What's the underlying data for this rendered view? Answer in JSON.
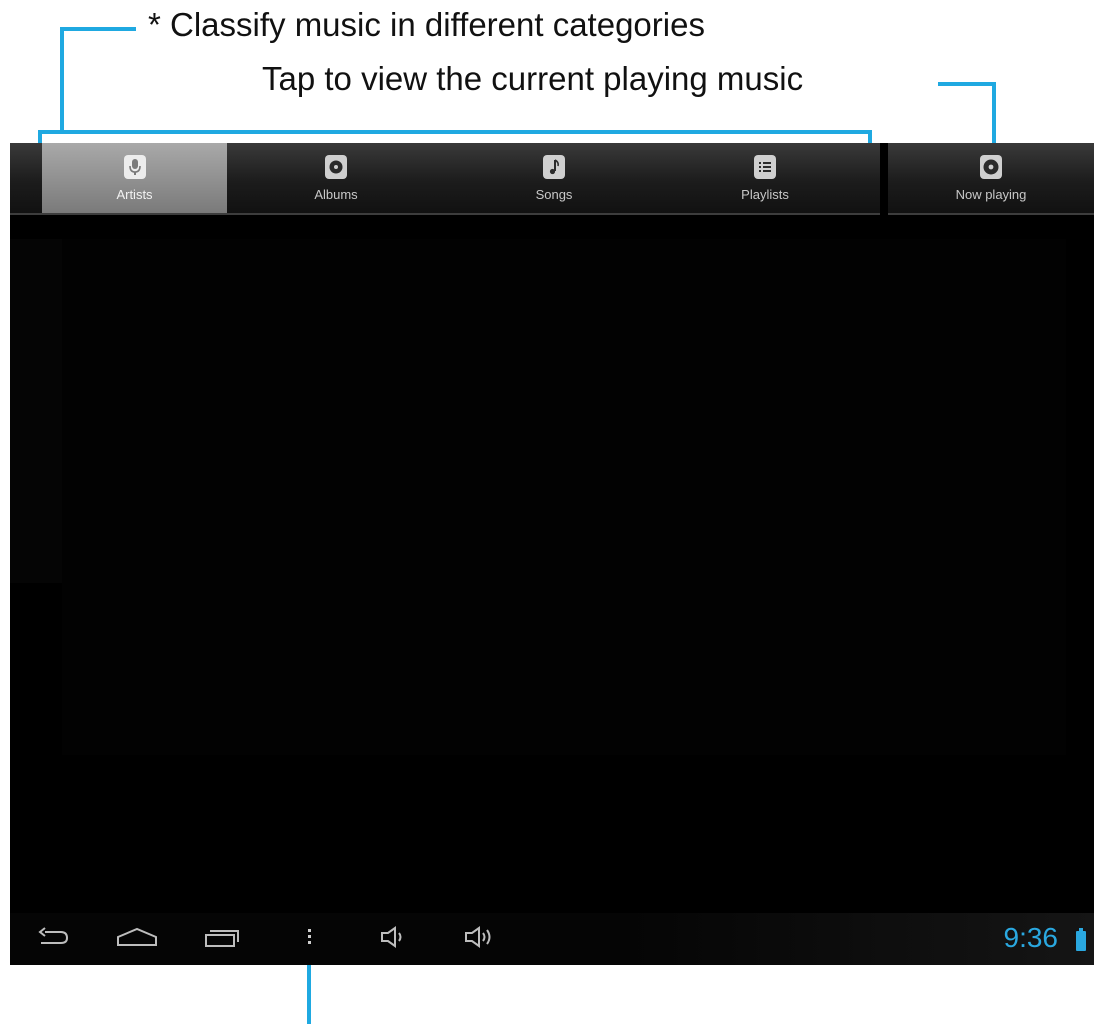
{
  "annotations": {
    "classify": "* Classify music in different categories",
    "now_playing": "Tap to view the current playing music"
  },
  "tabs": [
    {
      "label": "Artists",
      "icon": "microphone-icon",
      "selected": true
    },
    {
      "label": "Albums",
      "icon": "album-disc-icon",
      "selected": false
    },
    {
      "label": "Songs",
      "icon": "music-note-icon",
      "selected": false
    },
    {
      "label": "Playlists",
      "icon": "playlist-icon",
      "selected": false
    }
  ],
  "now_playing": {
    "label": "Now playing",
    "icon": "now-playing-disc-icon"
  },
  "navbar": {
    "buttons": [
      "back-icon",
      "home-icon",
      "recent-apps-icon",
      "menu-overflow-icon",
      "volume-down-icon",
      "volume-up-icon"
    ],
    "clock": "9:36",
    "battery_icon": "battery-icon"
  },
  "colors": {
    "callout": "#1fa9e1",
    "accent": "#2aa8e0",
    "background": "#000000"
  }
}
